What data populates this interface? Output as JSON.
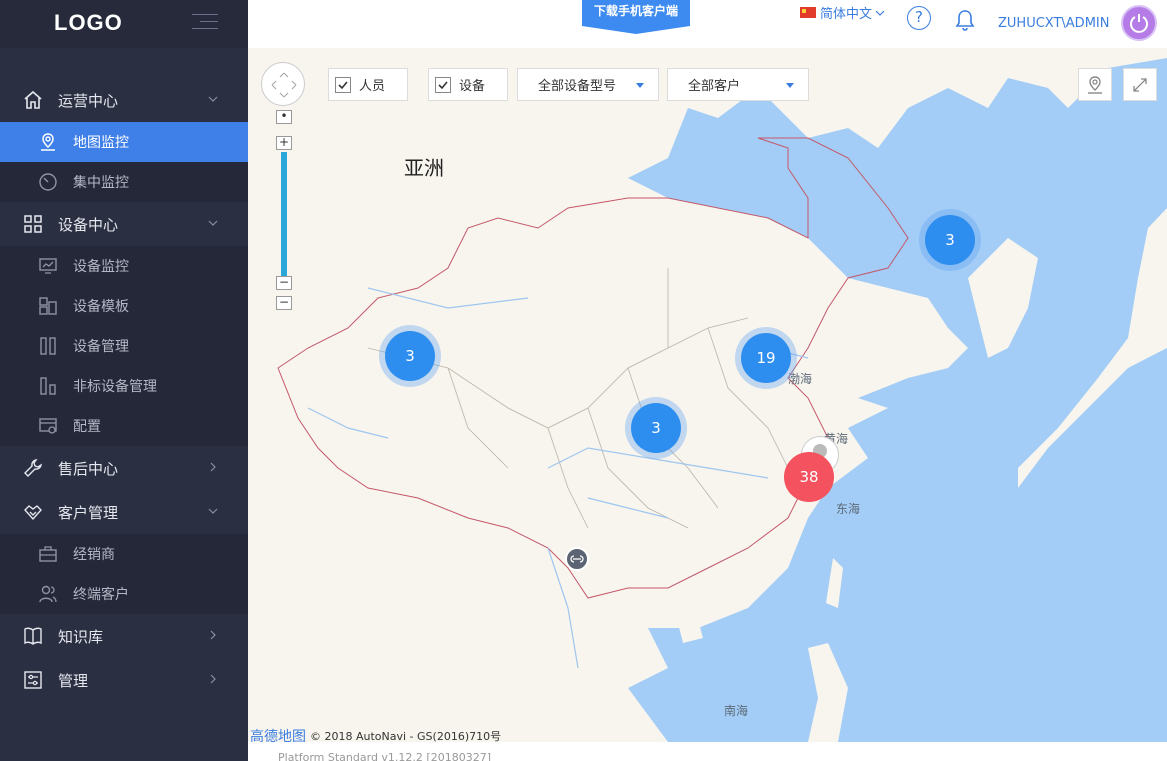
{
  "sidebar": {
    "logo": "LOGO",
    "groups": [
      {
        "label": "运营中心",
        "items": [
          {
            "label": "地图监控",
            "active": true
          },
          {
            "label": "集中监控"
          }
        ]
      },
      {
        "label": "设备中心",
        "items": [
          {
            "label": "设备监控"
          },
          {
            "label": "设备模板"
          },
          {
            "label": "设备管理"
          },
          {
            "label": "非标设备管理"
          },
          {
            "label": "配置"
          }
        ]
      },
      {
        "label": "售后中心",
        "items": []
      },
      {
        "label": "客户管理",
        "items": [
          {
            "label": "经销商"
          },
          {
            "label": "终端客户"
          }
        ]
      },
      {
        "label": "知识库",
        "items": []
      },
      {
        "label": "管理",
        "items": []
      }
    ]
  },
  "header": {
    "download_label": "下载手机客户端",
    "language": "简体中文",
    "help": "?",
    "user": "ZUHUCXT\\ADMIN"
  },
  "map": {
    "filters": {
      "person_label": "人员",
      "device_label": "设备",
      "model_select": "全部设备型号",
      "customer_select": "全部客户"
    },
    "continent": "亚洲",
    "seas": {
      "bohai": "渤海",
      "huanghai": "黄海",
      "donghai": "东海",
      "nanhai": "南海"
    },
    "clusters": {
      "c1": "3",
      "c2": "19",
      "c3": "3",
      "c4": "3",
      "c5": "38"
    },
    "attribution_brand": "高德地图",
    "attribution_text": "© 2018 AutoNavi - GS(2016)710号",
    "zoom_in": "+",
    "zoom_out": "−"
  },
  "footer": {
    "version": "Platform Standard v1.12.2 [20180327]"
  },
  "colors": {
    "sidebar": "#2b2f42",
    "active": "#3f80e8",
    "water": "#a3cdf6",
    "land": "#f8f5ee",
    "cluster": "#2d8ef0",
    "alert": "#f3525e"
  }
}
